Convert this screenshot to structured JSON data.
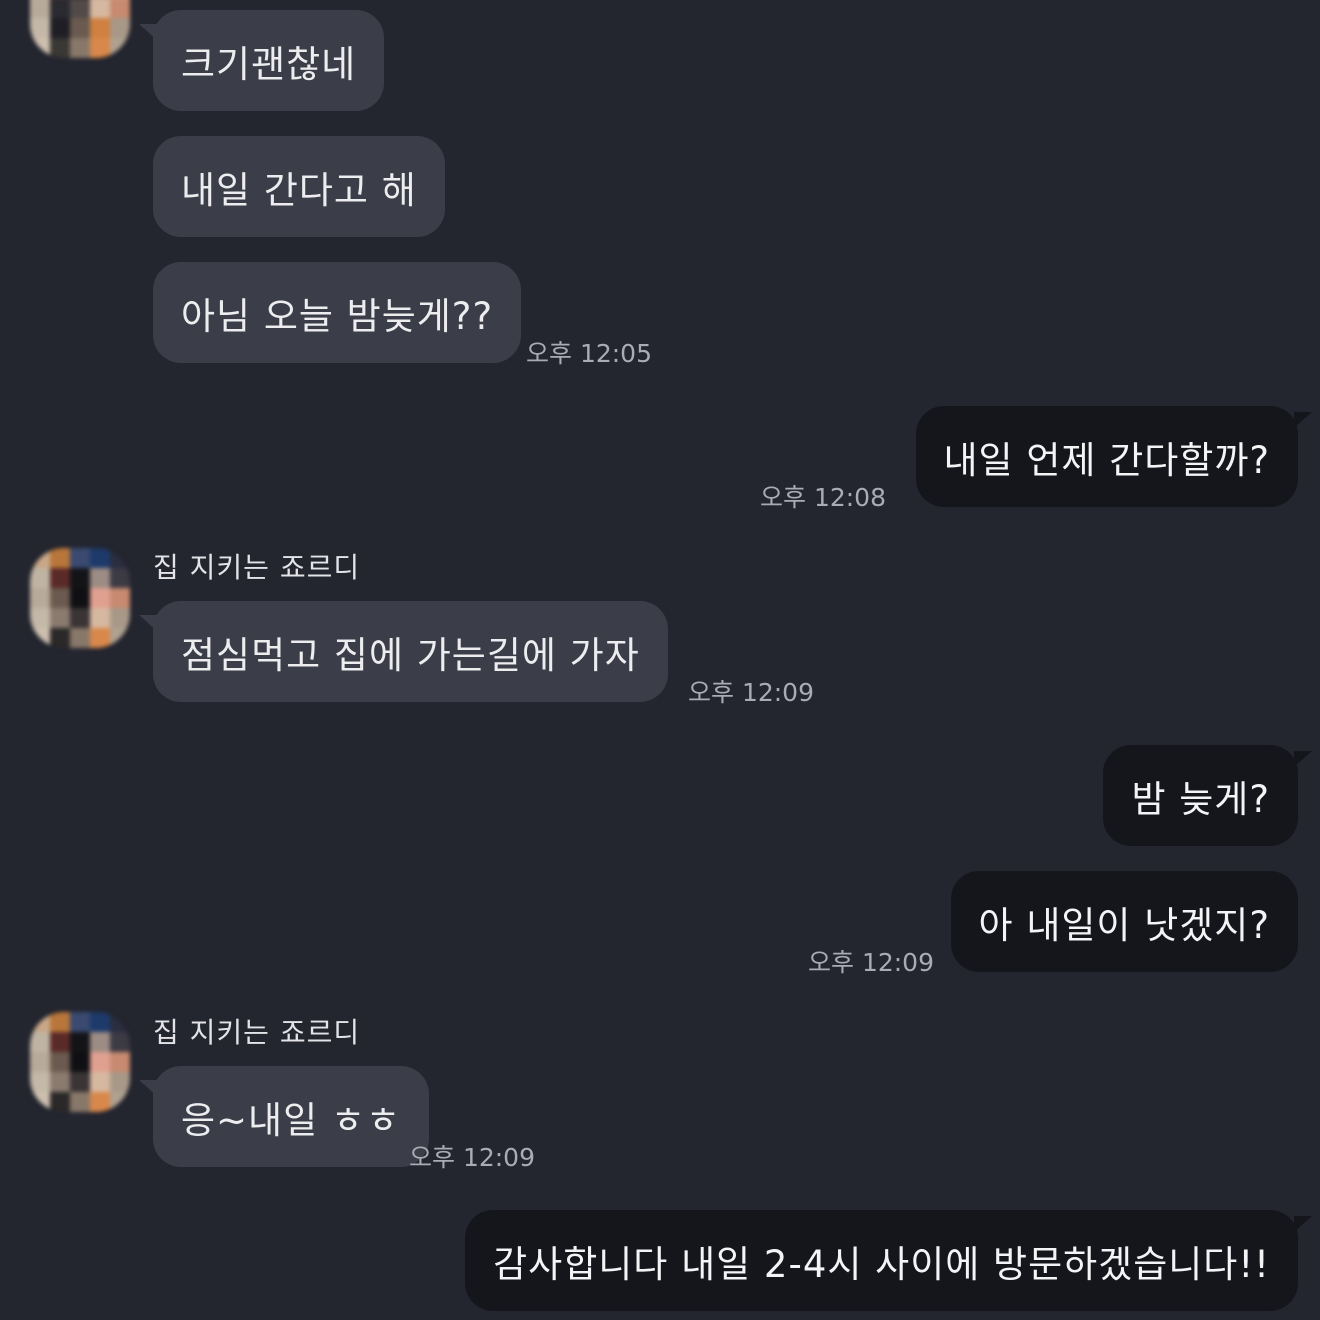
{
  "chat": {
    "sender_name": "집 지키는 죠르디",
    "messages": [
      {
        "text": "크기괜찮네"
      },
      {
        "text": "내일 간다고 해"
      },
      {
        "text": "아님 오늘 밤늦게??",
        "time": "오후 12:05"
      },
      {
        "text": "내일 언제 간다할까?",
        "time": "오후 12:08"
      },
      {
        "text": "점심먹고 집에 가는길에 가자",
        "time": "오후 12:09"
      },
      {
        "text": "밤 늦게?"
      },
      {
        "text": "아 내일이 낫겠지?",
        "time": "오후 12:09"
      },
      {
        "text": "응~내일 ㅎㅎ",
        "time": "오후 12:09"
      },
      {
        "text": "감사합니다 내일 2-4시 사이에 방문하겠습니다!!"
      }
    ]
  },
  "colors": {
    "background": "#23252f",
    "incoming_bubble": "#3b3d48",
    "outgoing_bubble": "#15161c",
    "timestamp": "#a9abb5"
  },
  "icons": {
    "avatar": "blurred-profile-avatar"
  }
}
